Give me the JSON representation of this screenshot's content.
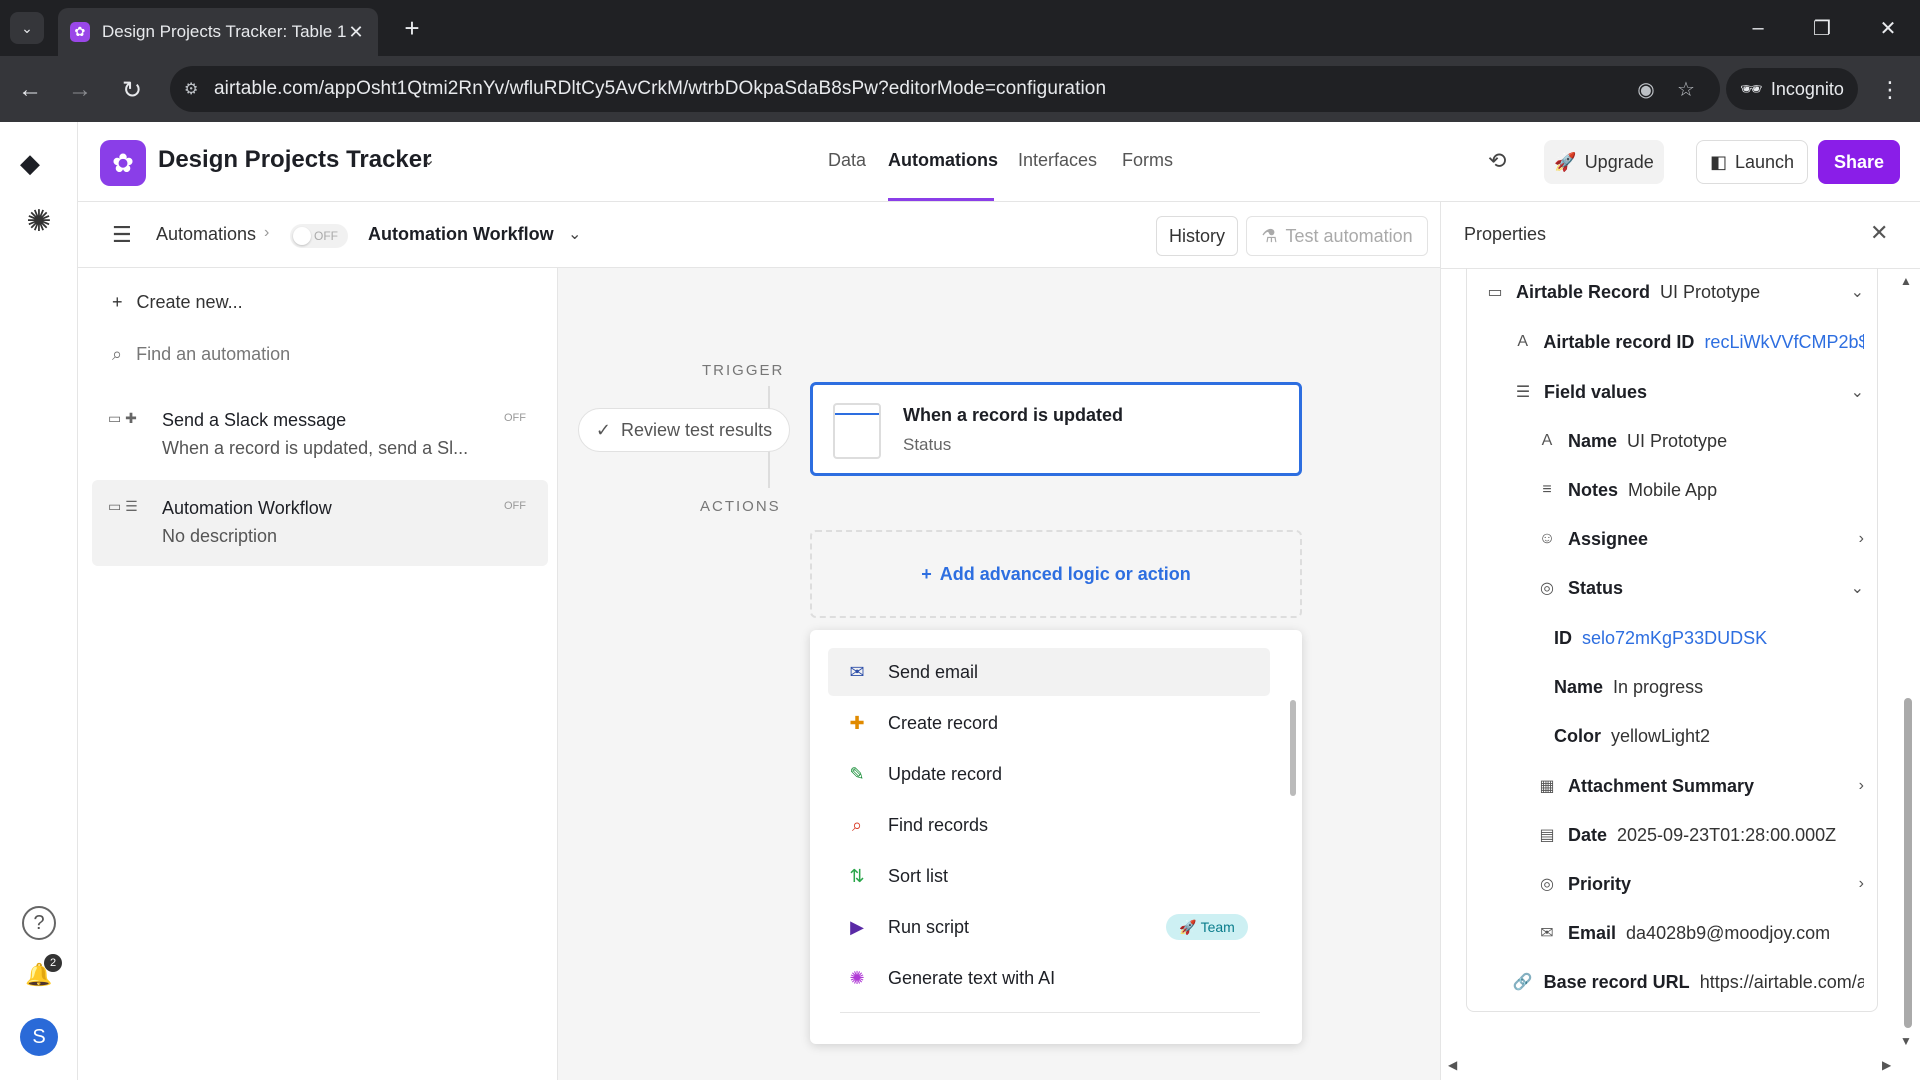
{
  "browser": {
    "tab_title": "Design Projects Tracker: Table 1",
    "url": "airtable.com/appOsht1Qtmi2RnYv/wfluRDltCy5AvCrkM/wtrbDOkpaSdaB8sPw?editorMode=configuration",
    "incognito_label": "Incognito"
  },
  "rail": {
    "notification_count": "2",
    "avatar_initial": "S"
  },
  "base": {
    "name": "Design Projects Tracker",
    "tabs": [
      "Data",
      "Automations",
      "Interfaces",
      "Forms"
    ],
    "upgrade_label": "Upgrade",
    "launch_label": "Launch",
    "share_label": "Share"
  },
  "subheader": {
    "breadcrumb_root": "Automations",
    "toggle_label": "OFF",
    "workflow_name": "Automation Workflow",
    "history_label": "History",
    "test_label": "Test automation"
  },
  "list": {
    "create_new": "Create new...",
    "search_placeholder": "Find an automation",
    "items": [
      {
        "name": "Send a Slack message",
        "description": "When a record is updated, send a Sl...",
        "status": "OFF"
      },
      {
        "name": "Automation Workflow",
        "description": "No description",
        "status": "OFF"
      }
    ]
  },
  "canvas": {
    "trigger_label": "TRIGGER",
    "actions_label": "ACTIONS",
    "review_label": "Review test results",
    "trigger_title": "When a record is updated",
    "trigger_sub": "Status",
    "add_logic_label": "Add advanced logic or action"
  },
  "dropdown": {
    "items": [
      {
        "label": "Send email",
        "icon": "envelope-icon",
        "color": "#2d4ea8"
      },
      {
        "label": "Create record",
        "icon": "plus-icon",
        "color": "#e08a00"
      },
      {
        "label": "Update record",
        "icon": "pencil-icon",
        "color": "#1a8f3a"
      },
      {
        "label": "Find records",
        "icon": "search-icon",
        "color": "#d9402b"
      },
      {
        "label": "Sort list",
        "icon": "sort-icon",
        "color": "#2aa64a"
      },
      {
        "label": "Run script",
        "icon": "play-icon",
        "color": "#5a2aa6"
      },
      {
        "label": "Generate text with AI",
        "icon": "ai-sparkle-icon",
        "color": "#b03ad6"
      }
    ],
    "team_badge": "Team"
  },
  "properties": {
    "title": "Properties",
    "rows": {
      "record_key": "Airtable Record",
      "record_val": "UI Prototype",
      "record_id_key": "Airtable record ID",
      "record_id_val": "recLiWkVVfCMP2b$",
      "field_values_key": "Field values",
      "name_key": "Name",
      "name_val": "UI Prototype",
      "notes_key": "Notes",
      "notes_val": "Mobile App",
      "assignee_key": "Assignee",
      "status_key": "Status",
      "status_id_key": "ID",
      "status_id_val": "selo72mKgP33DUDSK",
      "status_name_key": "Name",
      "status_name_val": "In progress",
      "status_color_key": "Color",
      "status_color_val": "yellowLight2",
      "attachment_key": "Attachment Summary",
      "date_key": "Date",
      "date_val": "2025-09-23T01:28:00.000Z",
      "priority_key": "Priority",
      "email_key": "Email",
      "email_val": "da4028b9@moodjoy.com",
      "url_key": "Base record URL",
      "url_val": "https://airtable.com/a"
    }
  }
}
